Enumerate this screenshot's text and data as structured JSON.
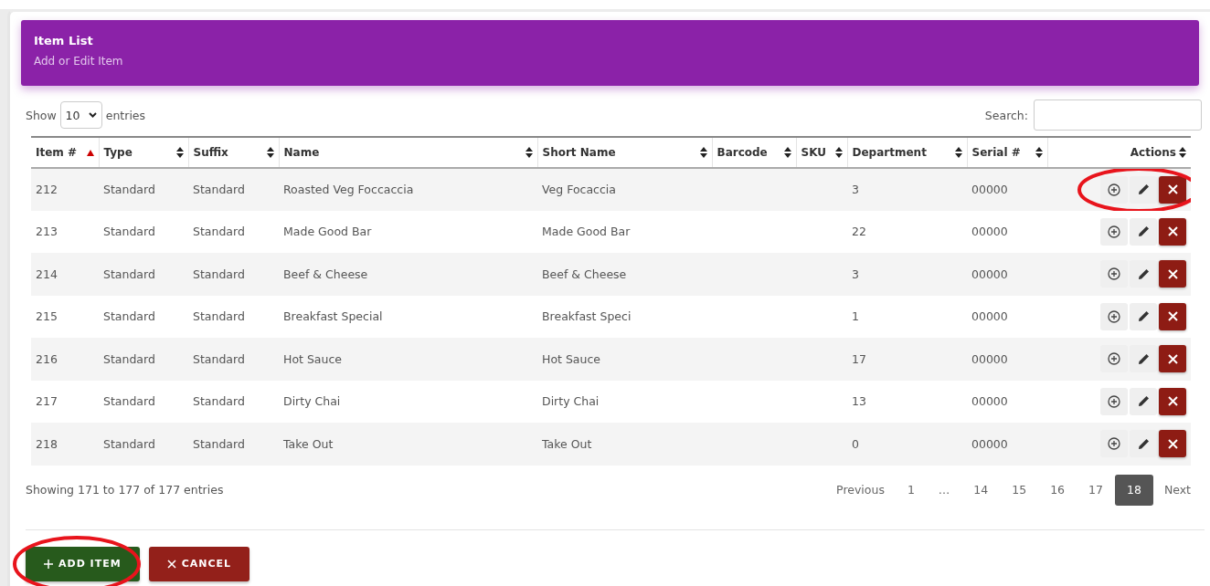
{
  "card": {
    "title": "Item List",
    "subtitle": "Add or Edit Item"
  },
  "length": {
    "label_before": "Show",
    "value": "10",
    "label_after": "entries"
  },
  "search": {
    "label": "Search:"
  },
  "table": {
    "columns": [
      {
        "label": "Item #",
        "sorted": true
      },
      {
        "label": "Type",
        "sorted": false
      },
      {
        "label": "Suffix",
        "sorted": false
      },
      {
        "label": "Name",
        "sorted": false
      },
      {
        "label": "Short Name",
        "sorted": false
      },
      {
        "label": "Barcode",
        "sorted": false
      },
      {
        "label": "SKU",
        "sorted": false
      },
      {
        "label": "Department",
        "sorted": false
      },
      {
        "label": "Serial #",
        "sorted": false
      },
      {
        "label": "Actions",
        "sorted": false
      }
    ],
    "rows": [
      {
        "cells": [
          "212",
          "Standard",
          "Standard",
          "Roasted Veg Foccaccia",
          "Veg Focaccia",
          "",
          "",
          "3",
          "00000"
        ],
        "circled": true
      },
      {
        "cells": [
          "213",
          "Standard",
          "Standard",
          "Made Good Bar",
          "Made Good Bar",
          "",
          "",
          "22",
          "00000"
        ],
        "circled": false
      },
      {
        "cells": [
          "214",
          "Standard",
          "Standard",
          "Beef & Cheese",
          "Beef & Cheese",
          "",
          "",
          "3",
          "00000"
        ],
        "circled": false
      },
      {
        "cells": [
          "215",
          "Standard",
          "Standard",
          "Breakfast Special",
          "Breakfast Speci",
          "",
          "",
          "1",
          "00000"
        ],
        "circled": false
      },
      {
        "cells": [
          "216",
          "Standard",
          "Standard",
          "Hot Sauce",
          "Hot Sauce",
          "",
          "",
          "17",
          "00000"
        ],
        "circled": false
      },
      {
        "cells": [
          "217",
          "Standard",
          "Standard",
          "Dirty Chai",
          "Dirty Chai",
          "",
          "",
          "13",
          "00000"
        ],
        "circled": false
      },
      {
        "cells": [
          "218",
          "Standard",
          "Standard",
          "Take Out",
          "Take Out",
          "",
          "",
          "0",
          "00000"
        ],
        "circled": false
      }
    ]
  },
  "info": "Showing 171 to 177 of 177 entries",
  "pagination": [
    {
      "label": "Previous",
      "selected": false
    },
    {
      "label": "1",
      "selected": false
    },
    {
      "label": "…",
      "selected": false
    },
    {
      "label": "14",
      "selected": false
    },
    {
      "label": "15",
      "selected": false
    },
    {
      "label": "16",
      "selected": false
    },
    {
      "label": "17",
      "selected": false
    },
    {
      "label": "18",
      "selected": true
    },
    {
      "label": "Next",
      "selected": false
    }
  ],
  "buttons": [
    {
      "kind": "add",
      "label": "ADD ITEM",
      "circled": true
    },
    {
      "kind": "cancel",
      "label": "CANCEL",
      "circled": false
    }
  ]
}
